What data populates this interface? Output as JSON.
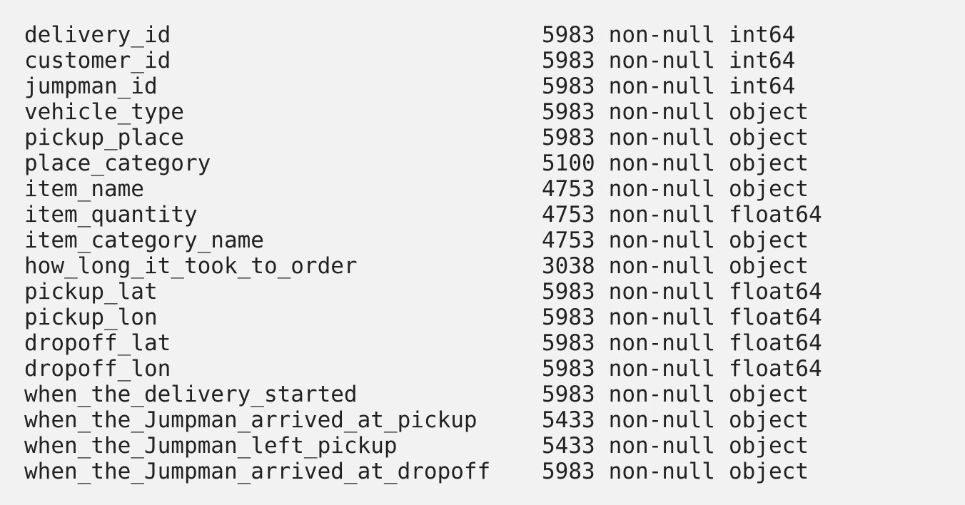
{
  "columns": [
    {
      "name": "delivery_id",
      "count": "5983",
      "nonnull": "non-null",
      "dtype": "int64"
    },
    {
      "name": "customer_id",
      "count": "5983",
      "nonnull": "non-null",
      "dtype": "int64"
    },
    {
      "name": "jumpman_id",
      "count": "5983",
      "nonnull": "non-null",
      "dtype": "int64"
    },
    {
      "name": "vehicle_type",
      "count": "5983",
      "nonnull": "non-null",
      "dtype": "object"
    },
    {
      "name": "pickup_place",
      "count": "5983",
      "nonnull": "non-null",
      "dtype": "object"
    },
    {
      "name": "place_category",
      "count": "5100",
      "nonnull": "non-null",
      "dtype": "object"
    },
    {
      "name": "item_name",
      "count": "4753",
      "nonnull": "non-null",
      "dtype": "object"
    },
    {
      "name": "item_quantity",
      "count": "4753",
      "nonnull": "non-null",
      "dtype": "float64"
    },
    {
      "name": "item_category_name",
      "count": "4753",
      "nonnull": "non-null",
      "dtype": "object"
    },
    {
      "name": "how_long_it_took_to_order",
      "count": "3038",
      "nonnull": "non-null",
      "dtype": "object"
    },
    {
      "name": "pickup_lat",
      "count": "5983",
      "nonnull": "non-null",
      "dtype": "float64"
    },
    {
      "name": "pickup_lon",
      "count": "5983",
      "nonnull": "non-null",
      "dtype": "float64"
    },
    {
      "name": "dropoff_lat",
      "count": "5983",
      "nonnull": "non-null",
      "dtype": "float64"
    },
    {
      "name": "dropoff_lon",
      "count": "5983",
      "nonnull": "non-null",
      "dtype": "float64"
    },
    {
      "name": "when_the_delivery_started",
      "count": "5983",
      "nonnull": "non-null",
      "dtype": "object"
    },
    {
      "name": "when_the_Jumpman_arrived_at_pickup",
      "count": "5433",
      "nonnull": "non-null",
      "dtype": "object"
    },
    {
      "name": "when_the_Jumpman_left_pickup",
      "count": "5433",
      "nonnull": "non-null",
      "dtype": "object"
    },
    {
      "name": "when_the_Jumpman_arrived_at_dropoff",
      "count": "5983",
      "nonnull": "non-null",
      "dtype": "object"
    }
  ]
}
